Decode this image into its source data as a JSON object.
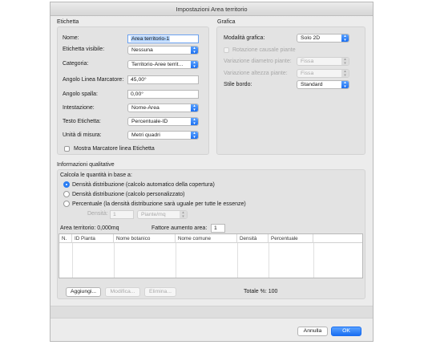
{
  "window": {
    "title": "Impostazioni Area territorio"
  },
  "etichetta": {
    "title": "Etichetta",
    "nome_label": "Nome:",
    "nome_value": "Area territorio-1",
    "visibile_label": "Etichetta visibile:",
    "visibile_value": "Nessuna",
    "categoria_label": "Categoria:",
    "categoria_value": "Territorio-Aree territ...",
    "angolo_linea_label": "Angolo Linea Marcatore:",
    "angolo_linea_value": "45,00°",
    "angolo_spalla_label": "Angolo spalla:",
    "angolo_spalla_value": "0,00°",
    "intestazione_label": "Intestazione:",
    "intestazione_value": "Nome-Area",
    "testo_label": "Testo Etichetta:",
    "testo_value": "Percentuale-ID",
    "unita_label": "Unità di misura:",
    "unita_value": "Metri quadri",
    "mostra_label": "Mostra Marcatore linea Etichetta"
  },
  "grafica": {
    "title": "Grafica",
    "modalita_label": "Modalità grafica:",
    "modalita_value": "Solo 2D",
    "rotazione_label": "Rotazione causale piante",
    "var_diametro_label": "Variazione diametro piante:",
    "var_diametro_value": "Fissa",
    "var_altezza_label": "Variazione altezza piante:",
    "var_altezza_value": "Fissa",
    "stile_label": "Stile bordo:",
    "stile_value": "Standard"
  },
  "qualitative": {
    "title": "Informazioni qualitative",
    "calcola_label": "Calcola le quantità in base a:",
    "radio1": "Densità distribuzione (calcolo automatico della copertura)",
    "radio2": "Densità distribuzione (calcolo personalizzato)",
    "radio3": "Percentuale (la densità distribuzione sarà uguale per tutte le essenze)",
    "densita_label": "Densità:",
    "densita_value": "1",
    "unita_value": "Piante/mq",
    "area_label": "Area territorio: 0,000mq",
    "fattore_label": "Fattore aumento area:",
    "fattore_value": "1",
    "table_headers": [
      "N.",
      "ID Pianta",
      "Nome botanico",
      "Nome comune",
      "Densità",
      "Percentuale"
    ],
    "aggiungi": "Aggiungi...",
    "modifica": "Modifica...",
    "elimina": "Elimina...",
    "totale": "Totale %:  100"
  },
  "footer": {
    "annulla": "Annulla",
    "ok": "OK"
  }
}
